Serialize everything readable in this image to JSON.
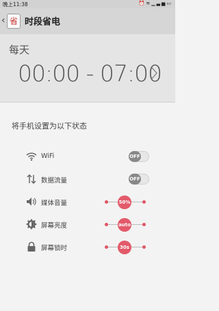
{
  "status_bar": {
    "time": "晚上11:38",
    "icons": [
      "alarm-icon",
      "wifi-icon",
      "signal-icon",
      "battery-icon"
    ]
  },
  "action_bar": {
    "app_icon_text": "省",
    "title": "时段省电"
  },
  "schedule": {
    "label": "每天",
    "range": "00:00 - 07:00"
  },
  "section_title": "将手机设置为以下状态",
  "settings": {
    "wifi": {
      "label": "WiFi",
      "value": "OFF"
    },
    "data": {
      "label": "数据流量",
      "value": "OFF"
    },
    "volume": {
      "label": "媒体音量",
      "value": "50%"
    },
    "brightness": {
      "label": "屏幕亮度",
      "value": "auto"
    },
    "lock": {
      "label": "屏幕锁时",
      "value": "30s"
    }
  },
  "colors": {
    "accent": "#e35a6a",
    "toggle_off": "#888888"
  }
}
